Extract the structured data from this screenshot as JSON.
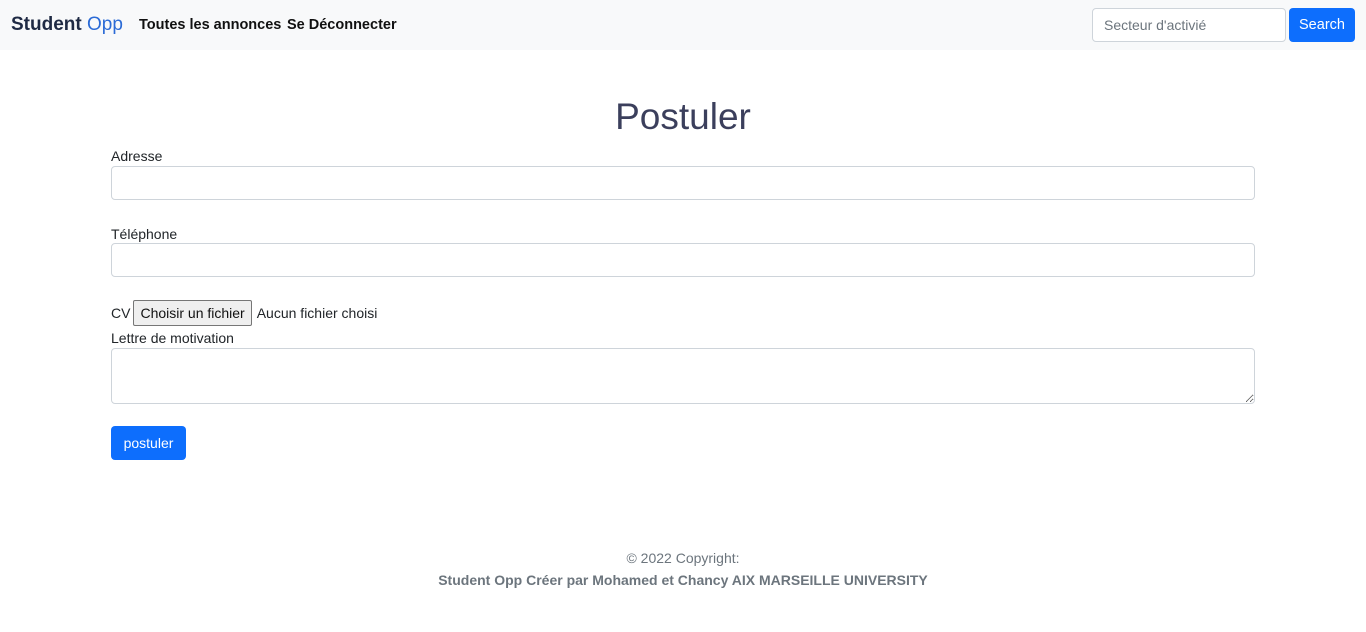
{
  "navbar": {
    "brand_bold": "Student",
    "brand_light": "Opp",
    "links": [
      "Toutes les annonces",
      "Se Déconnecter"
    ],
    "search": {
      "placeholder": "Secteur d'activié",
      "value": ""
    },
    "search_button": "Search"
  },
  "form": {
    "title": "Postuler",
    "adresse_label": "Adresse",
    "adresse_value": "",
    "telephone_label": "Téléphone",
    "telephone_value": "",
    "cv_label": "CV",
    "cv_button": "Choisir un fichier",
    "cv_status": "Aucun fichier choisi",
    "lettre_label": "Lettre de motivation",
    "lettre_value": "",
    "submit": "postuler"
  },
  "footer": {
    "copyright": "© 2022 Copyright:",
    "credits": "Student Opp Créer par Mohamed et Chancy AIX MARSEILLE UNIVERSITY"
  },
  "colors": {
    "primary": "#0d6efd",
    "navbar_bg": "#f8f9fa",
    "brand_accent": "#2b6bd6"
  }
}
